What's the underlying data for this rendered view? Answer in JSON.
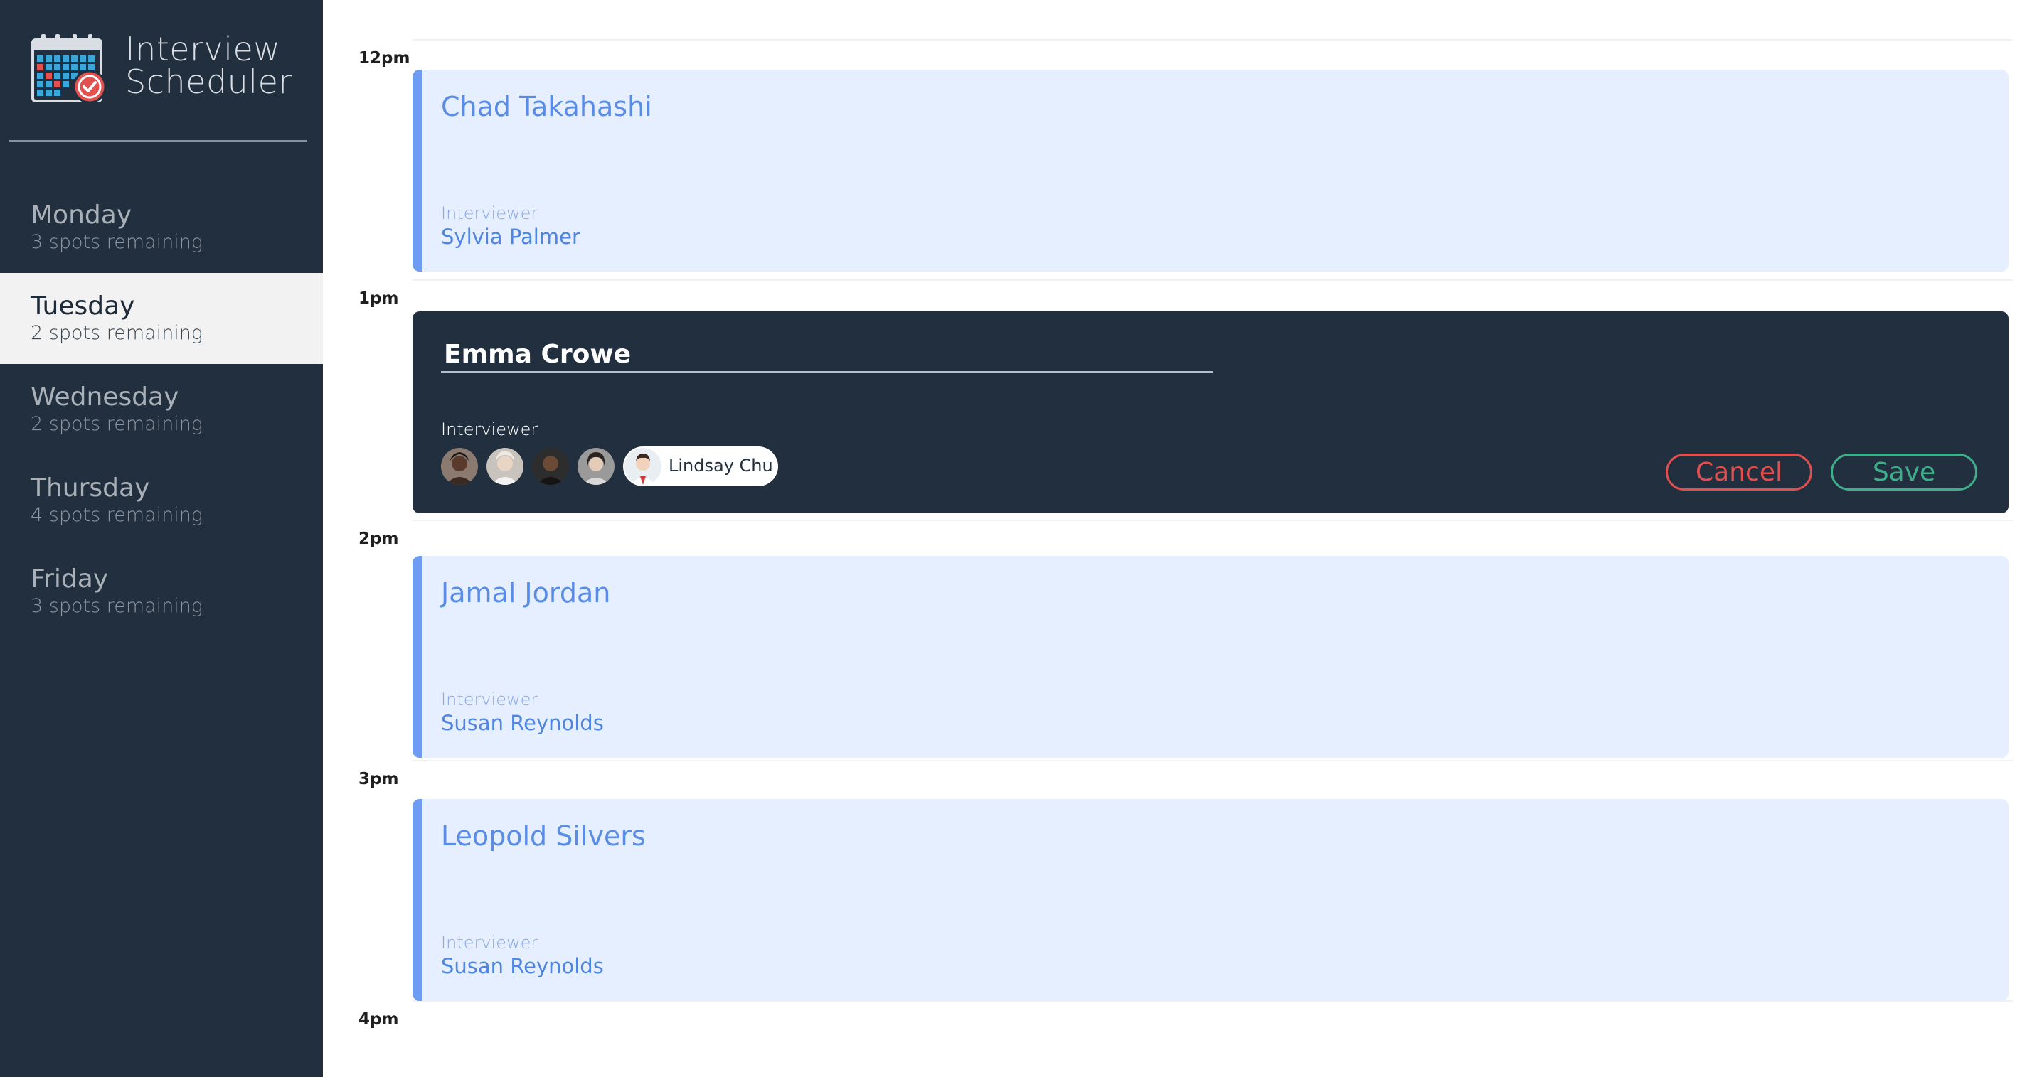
{
  "app": {
    "title_line1": "Interview",
    "title_line2": "Scheduler"
  },
  "sidebar": {
    "days": [
      {
        "name": "Monday",
        "spots": "3 spots remaining",
        "selected": false
      },
      {
        "name": "Tuesday",
        "spots": "2 spots remaining",
        "selected": true
      },
      {
        "name": "Wednesday",
        "spots": "2 spots remaining",
        "selected": false
      },
      {
        "name": "Thursday",
        "spots": "4 spots remaining",
        "selected": false
      },
      {
        "name": "Friday",
        "spots": "3 spots remaining",
        "selected": false
      }
    ]
  },
  "schedule": {
    "hours": [
      "12pm",
      "1pm",
      "2pm",
      "3pm",
      "4pm"
    ],
    "appointments": [
      {
        "time": "12pm",
        "student": "Chad Takahashi",
        "interviewer_label": "Interviewer",
        "interviewer": "Sylvia Palmer"
      },
      {
        "time": "2pm",
        "student": "Jamal Jordan",
        "interviewer_label": "Interviewer",
        "interviewer": "Susan Reynolds"
      },
      {
        "time": "3pm",
        "student": "Leopold Silvers",
        "interviewer_label": "Interviewer",
        "interviewer": "Susan Reynolds"
      }
    ],
    "form": {
      "time": "1pm",
      "student_value": "Emma Crowe",
      "interviewer_label": "Interviewer",
      "selected_interviewer": "Lindsay Chu",
      "avatar_icons": [
        "interviewer-avatar-1",
        "interviewer-avatar-2",
        "interviewer-avatar-3",
        "interviewer-avatar-4",
        "interviewer-avatar-selected"
      ],
      "cancel_label": "Cancel",
      "save_label": "Save"
    }
  },
  "colors": {
    "sidebar_bg": "#222f3e",
    "appointment_bg": "#e6efff",
    "appointment_accent": "#6d9cf2",
    "cancel": "#e24f4f",
    "save": "#3fae8b"
  }
}
